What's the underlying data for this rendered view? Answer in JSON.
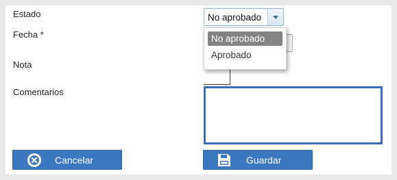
{
  "form": {
    "estado_label": "Estado",
    "fecha_label": "Fecha *",
    "nota_label": "Nota",
    "comentarios_label": "Comentarios",
    "estado_value": "No aprobado",
    "estado_options": [
      "No aprobado",
      "Aprobado"
    ],
    "comentarios_value": ""
  },
  "buttons": {
    "cancel_label": "Cancelar",
    "save_label": "Guardar"
  },
  "icons": {
    "cancel": "close-circle-icon",
    "save": "floppy-disk-icon",
    "dropdown": "chevron-down-icon"
  },
  "colors": {
    "button_bg": "#3c78c0",
    "textarea_border": "#3a6fb8",
    "selected_option_bg": "#838383",
    "page_bg": "#e9e9e9"
  }
}
